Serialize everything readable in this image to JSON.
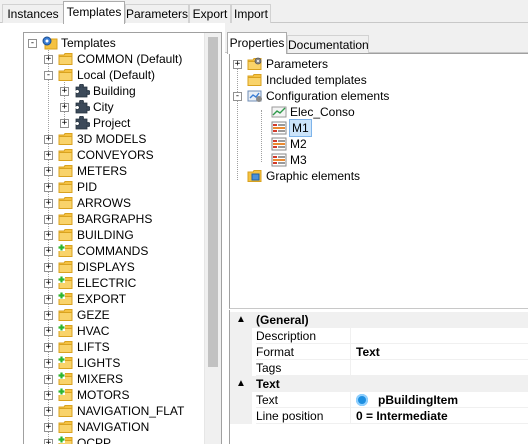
{
  "top_tabs": [
    {
      "label": "Instances",
      "active": false
    },
    {
      "label": "Templates",
      "active": true
    },
    {
      "label": "Parameters",
      "active": false
    },
    {
      "label": "Export",
      "active": false
    },
    {
      "label": "Import",
      "active": false
    }
  ],
  "tree": {
    "root": {
      "label": "Templates",
      "icon": "templates-folder-icon",
      "expanded": true
    },
    "items": [
      {
        "label": "COMMON (Default)",
        "icon": "folder-icon",
        "expander": "+"
      },
      {
        "label": "Local (Default)",
        "icon": "folder-icon",
        "expander": "-"
      },
      {
        "label": "Building",
        "icon": "puzzle-icon",
        "expander": "+"
      },
      {
        "label": "City",
        "icon": "puzzle-icon",
        "expander": "+"
      },
      {
        "label": "Project",
        "icon": "puzzle-icon",
        "expander": "+"
      },
      {
        "label": "3D MODELS",
        "icon": "folder-icon",
        "expander": "+"
      },
      {
        "label": "CONVEYORS",
        "icon": "folder-icon",
        "expander": "+"
      },
      {
        "label": "METERS",
        "icon": "folder-icon",
        "expander": "+"
      },
      {
        "label": "PID",
        "icon": "folder-icon",
        "expander": "+"
      },
      {
        "label": "ARROWS",
        "icon": "folder-icon",
        "expander": "+"
      },
      {
        "label": "BARGRAPHS",
        "icon": "folder-icon",
        "expander": "+"
      },
      {
        "label": "BUILDING",
        "icon": "folder-icon",
        "expander": "+"
      },
      {
        "label": "COMMANDS",
        "icon": "folder-plus-icon",
        "expander": "+"
      },
      {
        "label": "DISPLAYS",
        "icon": "folder-icon",
        "expander": "+"
      },
      {
        "label": "ELECTRIC",
        "icon": "folder-plus-icon",
        "expander": "+"
      },
      {
        "label": "EXPORT",
        "icon": "folder-plus-icon",
        "expander": "+"
      },
      {
        "label": "GEZE",
        "icon": "folder-icon",
        "expander": "+"
      },
      {
        "label": "HVAC",
        "icon": "folder-plus-icon",
        "expander": "+"
      },
      {
        "label": "LIFTS",
        "icon": "folder-icon",
        "expander": "+"
      },
      {
        "label": "LIGHTS",
        "icon": "folder-plus-icon",
        "expander": "+"
      },
      {
        "label": "MIXERS",
        "icon": "folder-plus-icon",
        "expander": "+"
      },
      {
        "label": "MOTORS",
        "icon": "folder-plus-icon",
        "expander": "+"
      },
      {
        "label": "NAVIGATION_FLAT",
        "icon": "folder-icon",
        "expander": "+"
      },
      {
        "label": "NAVIGATION",
        "icon": "folder-icon",
        "expander": "+"
      },
      {
        "label": "OCPP",
        "icon": "folder-plus-icon",
        "expander": "+"
      }
    ]
  },
  "sub_tabs": [
    {
      "label": "Properties",
      "active": true
    },
    {
      "label": "Documentation",
      "active": false
    }
  ],
  "props_tree": {
    "items": [
      {
        "label": "Parameters",
        "icon": "parameters-icon",
        "expander": "+"
      },
      {
        "label": "Included templates",
        "icon": "folder-icon",
        "expander": ""
      },
      {
        "label": "Configuration elements",
        "icon": "configuration-icon",
        "expander": "-"
      },
      {
        "label": "Elec_Conso",
        "icon": "chart-icon",
        "expander": ""
      },
      {
        "label": "M1",
        "icon": "element-icon",
        "expander": "",
        "selected": true
      },
      {
        "label": "M2",
        "icon": "element-icon",
        "expander": ""
      },
      {
        "label": "M3",
        "icon": "element-icon",
        "expander": ""
      },
      {
        "label": "Graphic elements",
        "icon": "graphic-elements-icon",
        "expander": ""
      }
    ]
  },
  "property_grid": {
    "general": {
      "category": "(General)",
      "rows": [
        {
          "name": "Description",
          "value": ""
        },
        {
          "name": "Format",
          "value": "Text"
        },
        {
          "name": "Tags",
          "value": ""
        }
      ]
    },
    "text": {
      "category": "Text",
      "rows": [
        {
          "name": "Text",
          "value": "pBuildingItem",
          "icon": "item-icon"
        },
        {
          "name": "Line position",
          "value": "0 = Intermediate"
        }
      ]
    },
    "collapse_glyph": "▲"
  },
  "colors": {
    "folder": "#f5c242",
    "folder_dark": "#d9a21f",
    "plus_green": "#2db52d",
    "selection_border": "#7eb4ea",
    "accent": "#1e8fe0"
  }
}
